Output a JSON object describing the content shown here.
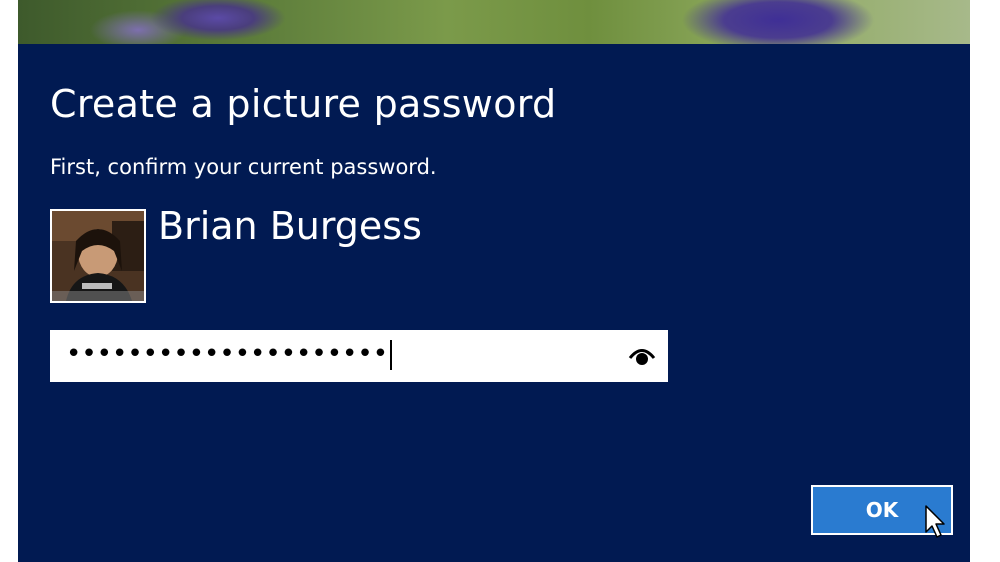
{
  "dialog": {
    "title": "Create a picture password",
    "subtitle": "First, confirm your current password.",
    "bg_color": "#011a52"
  },
  "user": {
    "name": "Brian Burgess"
  },
  "password": {
    "masked_value": "•••••••••••••••••••••",
    "reveal_icon": "eye-icon"
  },
  "actions": {
    "ok_label": "OK",
    "ok_color": "#2a7bd0"
  },
  "pointer": {
    "icon": "mouse-pointer-icon"
  }
}
